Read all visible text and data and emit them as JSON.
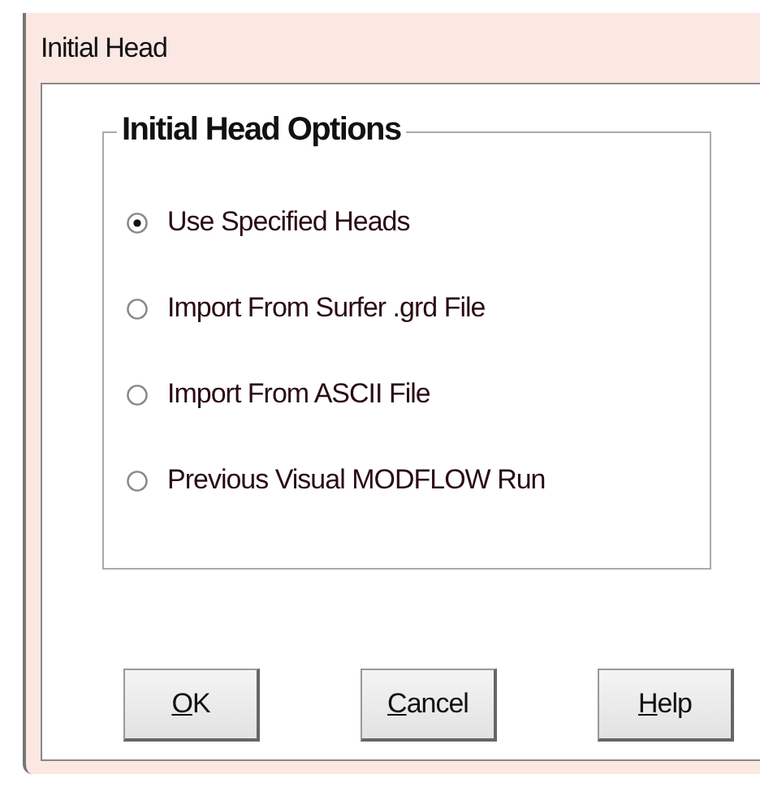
{
  "window": {
    "title": "Initial Head"
  },
  "group": {
    "title": "Initial Head Options",
    "options": [
      {
        "label": "Use Specified Heads",
        "selected": true
      },
      {
        "label": "Import From Surfer .grd File",
        "selected": false
      },
      {
        "label": "Import From ASCII File",
        "selected": false
      },
      {
        "label": "Previous Visual MODFLOW Run",
        "selected": false
      }
    ]
  },
  "buttons": [
    {
      "label": "OK"
    },
    {
      "label": "Cancel"
    },
    {
      "label": "Help"
    }
  ]
}
